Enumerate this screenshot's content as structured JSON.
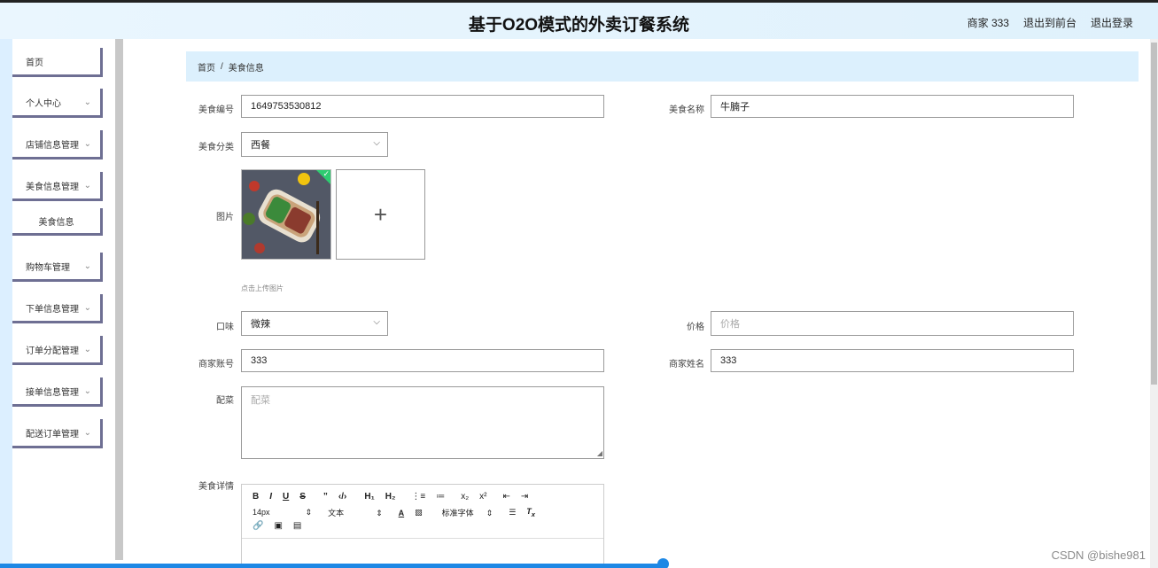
{
  "app": {
    "title": "基于O2O模式的外卖订餐系统"
  },
  "header_links": {
    "user": "商家 333",
    "to_front": "退出到前台",
    "logout": "退出登录"
  },
  "sidebar": {
    "items": [
      {
        "label": "首页",
        "has_chevron": false
      },
      {
        "label": "个人中心",
        "has_chevron": true
      },
      {
        "label": "店铺信息管理",
        "has_chevron": true
      },
      {
        "label": "美食信息管理",
        "has_chevron": true
      },
      {
        "label": "购物车管理",
        "has_chevron": true
      },
      {
        "label": "下单信息管理",
        "has_chevron": true
      },
      {
        "label": "订单分配管理",
        "has_chevron": true
      },
      {
        "label": "接单信息管理",
        "has_chevron": true
      },
      {
        "label": "配送订单管理",
        "has_chevron": true
      }
    ],
    "sub_item": "美食信息"
  },
  "breadcrumb": {
    "home": "首页",
    "sep": "/",
    "current": "美食信息"
  },
  "form": {
    "food_id": {
      "label": "美食编号",
      "value": "1649753530812"
    },
    "food_name": {
      "label": "美食名称",
      "value": "牛腩子"
    },
    "category": {
      "label": "美食分类",
      "value": "西餐"
    },
    "image": {
      "label": "图片",
      "hint": "点击上传图片"
    },
    "taste": {
      "label": "口味",
      "value": "微辣"
    },
    "price": {
      "label": "价格",
      "placeholder": "价格"
    },
    "merchant_account": {
      "label": "商家账号",
      "value": "333"
    },
    "merchant_name": {
      "label": "商家姓名",
      "value": "333"
    },
    "side_dish": {
      "label": "配菜",
      "placeholder": "配菜"
    },
    "details": {
      "label": "美食详情"
    }
  },
  "editor": {
    "row1": [
      "B",
      "I",
      "U",
      "S",
      "”",
      "‹/›",
      "H₁",
      "H₂",
      "⋮≡",
      "≔",
      "x₂",
      "x²",
      "⇤",
      "⇥"
    ],
    "font_size": "14px",
    "text_type": "文本",
    "font_family": "标准字体"
  },
  "watermark": "CSDN @bishe981"
}
